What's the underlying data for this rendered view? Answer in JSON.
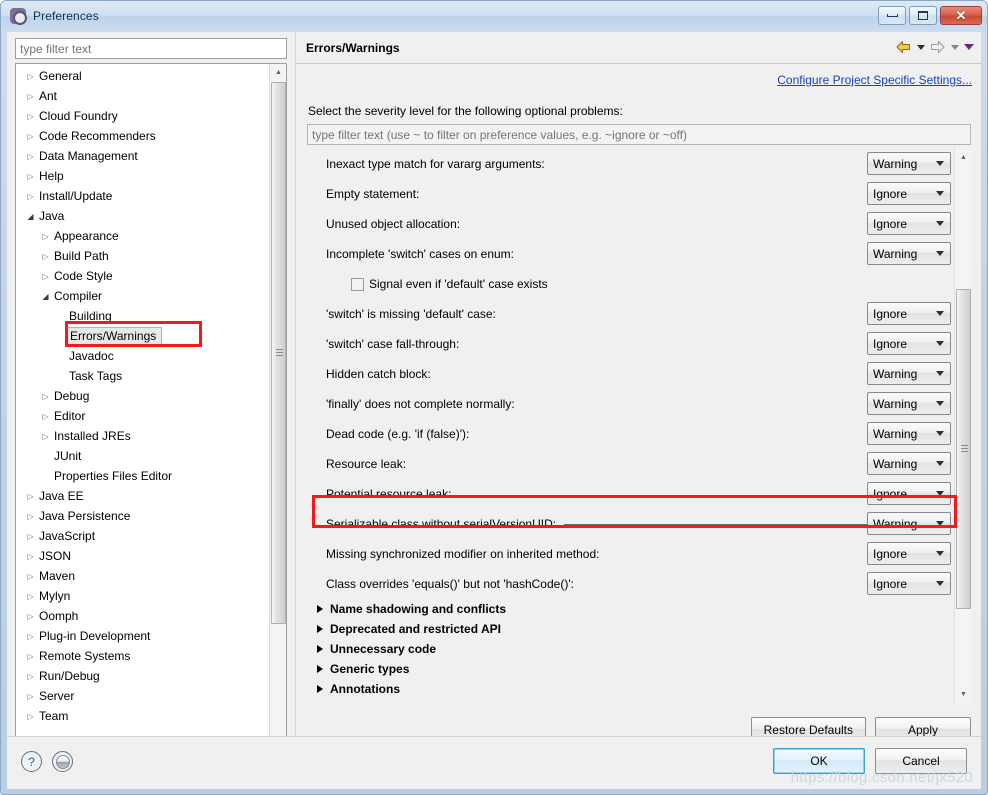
{
  "window": {
    "title": "Preferences",
    "icon": "gear-icon",
    "controls": {
      "minimize": "minimize",
      "maximize": "restore",
      "close": "close"
    }
  },
  "sidebar": {
    "filter_placeholder": "type filter text",
    "tree": [
      {
        "label": "General",
        "indent": 0,
        "state": "collapsed"
      },
      {
        "label": "Ant",
        "indent": 0,
        "state": "collapsed"
      },
      {
        "label": "Cloud Foundry",
        "indent": 0,
        "state": "collapsed"
      },
      {
        "label": "Code Recommenders",
        "indent": 0,
        "state": "collapsed"
      },
      {
        "label": "Data Management",
        "indent": 0,
        "state": "collapsed"
      },
      {
        "label": "Help",
        "indent": 0,
        "state": "collapsed"
      },
      {
        "label": "Install/Update",
        "indent": 0,
        "state": "collapsed"
      },
      {
        "label": "Java",
        "indent": 0,
        "state": "expanded"
      },
      {
        "label": "Appearance",
        "indent": 1,
        "state": "collapsed"
      },
      {
        "label": "Build Path",
        "indent": 1,
        "state": "collapsed"
      },
      {
        "label": "Code Style",
        "indent": 1,
        "state": "collapsed"
      },
      {
        "label": "Compiler",
        "indent": 1,
        "state": "expanded"
      },
      {
        "label": "Building",
        "indent": 2,
        "state": "leaf"
      },
      {
        "label": "Errors/Warnings",
        "indent": 2,
        "state": "leaf",
        "selected": true
      },
      {
        "label": "Javadoc",
        "indent": 2,
        "state": "leaf"
      },
      {
        "label": "Task Tags",
        "indent": 2,
        "state": "leaf"
      },
      {
        "label": "Debug",
        "indent": 1,
        "state": "collapsed"
      },
      {
        "label": "Editor",
        "indent": 1,
        "state": "collapsed"
      },
      {
        "label": "Installed JREs",
        "indent": 1,
        "state": "collapsed"
      },
      {
        "label": "JUnit",
        "indent": 1,
        "state": "leaf"
      },
      {
        "label": "Properties Files Editor",
        "indent": 1,
        "state": "leaf"
      },
      {
        "label": "Java EE",
        "indent": 0,
        "state": "collapsed"
      },
      {
        "label": "Java Persistence",
        "indent": 0,
        "state": "collapsed"
      },
      {
        "label": "JavaScript",
        "indent": 0,
        "state": "collapsed"
      },
      {
        "label": "JSON",
        "indent": 0,
        "state": "collapsed"
      },
      {
        "label": "Maven",
        "indent": 0,
        "state": "collapsed"
      },
      {
        "label": "Mylyn",
        "indent": 0,
        "state": "collapsed"
      },
      {
        "label": "Oomph",
        "indent": 0,
        "state": "collapsed"
      },
      {
        "label": "Plug-in Development",
        "indent": 0,
        "state": "collapsed"
      },
      {
        "label": "Remote Systems",
        "indent": 0,
        "state": "collapsed"
      },
      {
        "label": "Run/Debug",
        "indent": 0,
        "state": "collapsed"
      },
      {
        "label": "Server",
        "indent": 0,
        "state": "collapsed"
      },
      {
        "label": "Team",
        "indent": 0,
        "state": "collapsed"
      }
    ]
  },
  "main": {
    "page_title": "Errors/Warnings",
    "configure_link": "Configure Project Specific Settings...",
    "select_label": "Select the severity level for the following optional problems:",
    "options_filter_placeholder": "type filter text (use ~ to filter on preference values, e.g. ~ignore or ~off)",
    "nav": {
      "back": "back-arrow",
      "back_menu": "back-dropdown",
      "forward": "forward-arrow",
      "forward_menu": "forward-dropdown",
      "view_menu": "view-menu"
    },
    "rows": [
      {
        "kind": "combo",
        "label": "Inexact type match for vararg arguments:",
        "value": "Warning"
      },
      {
        "kind": "combo",
        "label": "Empty statement:",
        "value": "Ignore"
      },
      {
        "kind": "combo",
        "label": "Unused object allocation:",
        "value": "Ignore"
      },
      {
        "kind": "combo",
        "label": "Incomplete 'switch' cases on enum:",
        "value": "Warning"
      },
      {
        "kind": "checkbox",
        "label": "Signal even if 'default' case exists",
        "checked": false
      },
      {
        "kind": "combo",
        "label": "'switch' is missing 'default' case:",
        "value": "Ignore"
      },
      {
        "kind": "combo",
        "label": "'switch' case fall-through:",
        "value": "Ignore"
      },
      {
        "kind": "combo",
        "label": "Hidden catch block:",
        "value": "Warning"
      },
      {
        "kind": "combo",
        "label": "'finally' does not complete normally:",
        "value": "Warning"
      },
      {
        "kind": "combo",
        "label": "Dead code (e.g. 'if (false)'):",
        "value": "Warning"
      },
      {
        "kind": "combo",
        "label": "Resource leak:",
        "value": "Warning"
      },
      {
        "kind": "combo",
        "label": "Potential resource leak:",
        "value": "Ignore"
      },
      {
        "kind": "combo",
        "label": "Serializable class without serialVersionUID:",
        "value": "Warning",
        "highlighted": true,
        "leader": true
      },
      {
        "kind": "combo",
        "label": "Missing synchronized modifier on inherited method:",
        "value": "Ignore"
      },
      {
        "kind": "combo",
        "label": "Class overrides 'equals()' but not 'hashCode()':",
        "value": "Ignore"
      },
      {
        "kind": "group",
        "label": "Name shadowing and conflicts"
      },
      {
        "kind": "group",
        "label": "Deprecated and restricted API"
      },
      {
        "kind": "group",
        "label": "Unnecessary code"
      },
      {
        "kind": "group",
        "label": "Generic types"
      },
      {
        "kind": "group",
        "label": "Annotations"
      }
    ],
    "restore_defaults_label": "Restore Defaults",
    "apply_label": "Apply"
  },
  "footer": {
    "help_icon": "?",
    "ok_label": "OK",
    "cancel_label": "Cancel",
    "watermark": "https://blog.csdn.net/jx520"
  },
  "colors": {
    "annotation": "#f51919",
    "link": "#1a3fbf",
    "title_bar": "#cfe0f0"
  }
}
